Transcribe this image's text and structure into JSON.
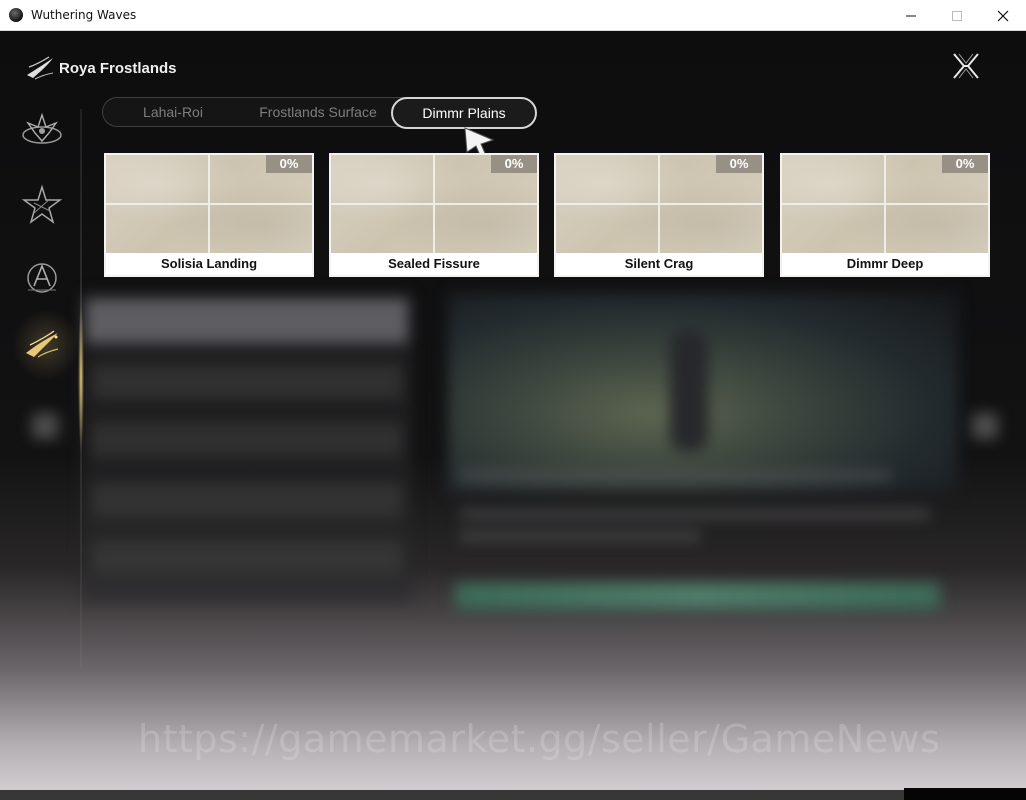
{
  "window": {
    "title": "Wuthering Waves"
  },
  "header": {
    "region_title": "Roya Frostlands"
  },
  "tabs": [
    {
      "label": "Lahai-Roi",
      "active": false
    },
    {
      "label": "Frostlands Surface",
      "active": false
    },
    {
      "label": "Dimmr Plains",
      "active": true
    }
  ],
  "cards": [
    {
      "name": "Solisia Landing",
      "progress": "0%"
    },
    {
      "name": "Sealed Fissure",
      "progress": "0%"
    },
    {
      "name": "Silent Crag",
      "progress": "0%"
    },
    {
      "name": "Dimmr Deep",
      "progress": "0%"
    }
  ],
  "sidebar": {
    "items": [
      {
        "icon": "lahai-roi-emblem-icon",
        "active": false
      },
      {
        "icon": "star-emblem-icon",
        "active": false
      },
      {
        "icon": "crest-emblem-icon",
        "active": false
      },
      {
        "icon": "roya-frostlands-emblem-icon",
        "active": true
      }
    ]
  },
  "watermark": "https://gamemarket.gg/seller/GameNews",
  "colors": {
    "active_tab_border": "#d6d6d6",
    "active_glow": "#f0d282",
    "card_progress_bg": "#8c867c"
  }
}
